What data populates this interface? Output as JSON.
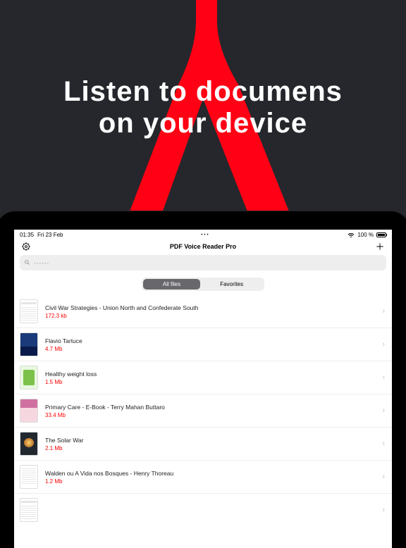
{
  "headline_line1": "Listen to documens",
  "headline_line2": "on your device",
  "statusbar": {
    "time": "01:35",
    "date": "Fri 23 Feb",
    "battery_pct": "100 %"
  },
  "topbar": {
    "title": "PDF Voice Reader Pro"
  },
  "search": {
    "placeholder": "------"
  },
  "tabs": {
    "all": "All files",
    "fav": "Favorites"
  },
  "files": [
    {
      "title": "Civil War Strategies - Union North and Confederate South",
      "size": "172.3 kb",
      "thumb": "doclines"
    },
    {
      "title": "Flavio Tartuce",
      "size": "4.7 Mb",
      "thumb": "blue"
    },
    {
      "title": "Healthy weight loss",
      "size": "1.5 Mb",
      "thumb": "green"
    },
    {
      "title": "Primary Care - E-Book - Terry Mahan Buttaro",
      "size": "33.4 Mb",
      "thumb": "pink"
    },
    {
      "title": "The Solar War",
      "size": "2.1 Mb",
      "thumb": "solar"
    },
    {
      "title": "Walden ou A Vida nos Bosques - Henry Thoreau",
      "size": "1.2 Mb",
      "thumb": "text"
    }
  ]
}
